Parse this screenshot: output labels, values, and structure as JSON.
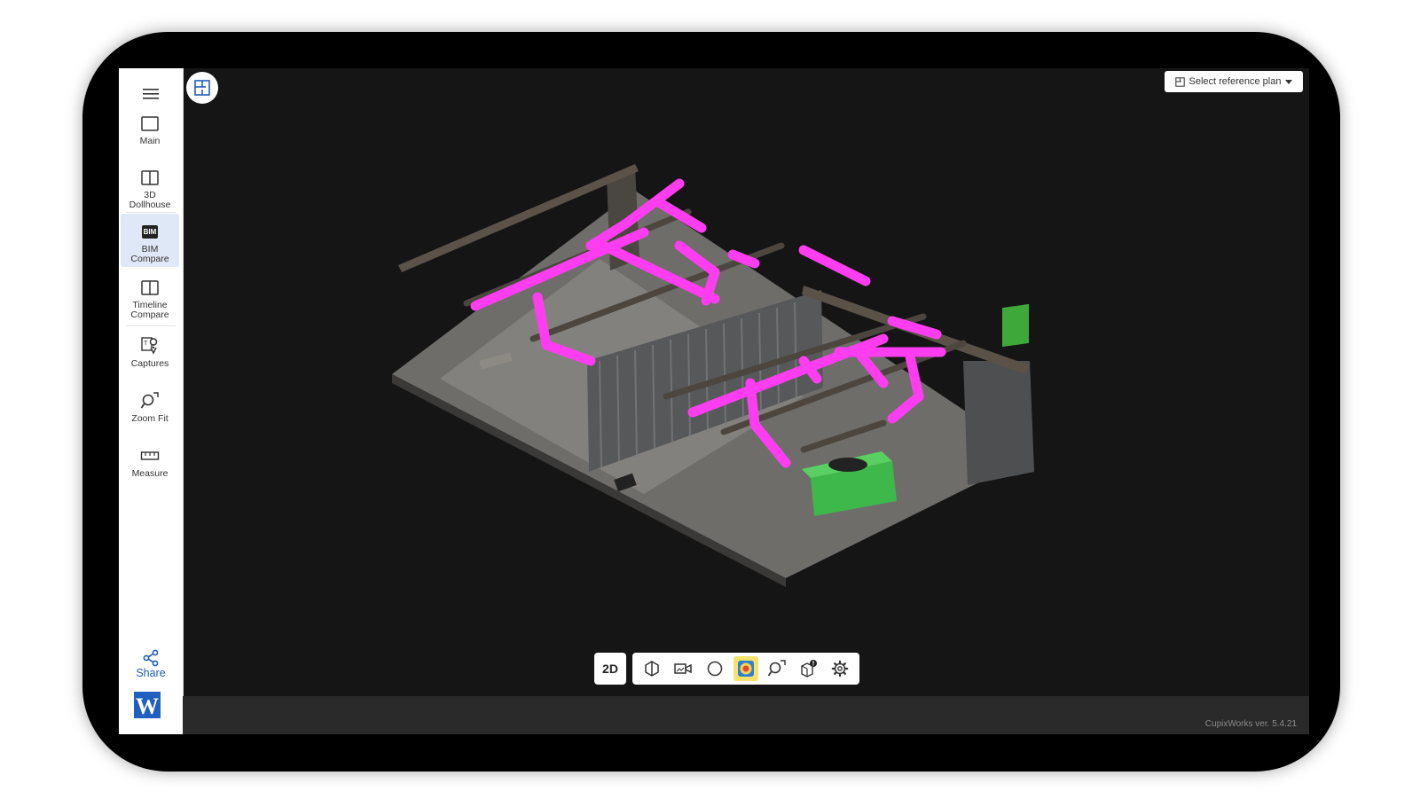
{
  "sidebar": {
    "items": [
      {
        "label": "Main",
        "icon": "square-icon"
      },
      {
        "label": "3D Dollhouse",
        "icon": "split-panel-icon"
      },
      {
        "label": "BIM Compare",
        "icon": "bim-icon",
        "badge": "BIM",
        "active": true
      },
      {
        "label": "Timeline Compare",
        "icon": "split-panel-icon"
      },
      {
        "label": "Captures",
        "icon": "capture-pin-icon"
      },
      {
        "label": "Zoom Fit",
        "icon": "zoom-fit-icon"
      },
      {
        "label": "Measure",
        "icon": "ruler-icon"
      }
    ],
    "share_label": "Share",
    "logo_text": "W"
  },
  "viewport": {
    "reference_plan_label": "Select reference plan"
  },
  "toolbar": {
    "mode_label": "2D",
    "buttons": [
      "cube-view-icon",
      "video-camera-icon",
      "circle-icon",
      "heatmap-icon",
      "search-icon",
      "issue-box-icon",
      "gear-icon"
    ]
  },
  "status": {
    "version": "CupixWorks ver. 5.4.21"
  },
  "colors": {
    "accent": "#1e5eb8",
    "bim_pipe": "#ff3df0",
    "active_tool": "#f7e26b"
  }
}
